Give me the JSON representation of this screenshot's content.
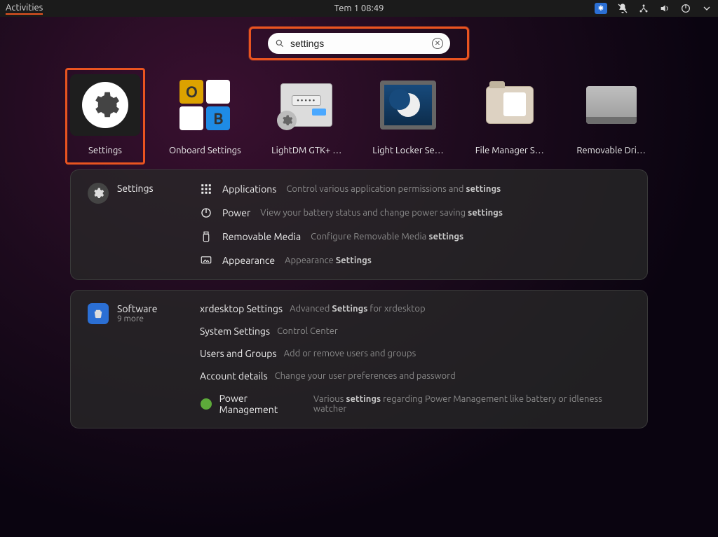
{
  "topbar": {
    "activities": "Activities",
    "clock": "Tem 1  08:49"
  },
  "search": {
    "value": "settings"
  },
  "apps": [
    {
      "id": "settings",
      "label": "Settings",
      "highlighted": true
    },
    {
      "id": "onboard-settings",
      "label": "Onboard Settings",
      "highlighted": false
    },
    {
      "id": "lightdm-gtk",
      "label": "LightDM GTK+ …",
      "highlighted": false
    },
    {
      "id": "light-locker",
      "label": "Light Locker Se…",
      "highlighted": false
    },
    {
      "id": "file-manager",
      "label": "File Manager S…",
      "highlighted": false
    },
    {
      "id": "removable",
      "label": "Removable Dri…",
      "highlighted": false
    }
  ],
  "settings_panel": {
    "title": "Settings",
    "rows": [
      {
        "icon": "grid",
        "label": "Applications",
        "desc_pre": "Control various application permissions and ",
        "desc_bold": "settings",
        "desc_post": ""
      },
      {
        "icon": "power",
        "label": "Power",
        "desc_pre": "View your battery status and change power saving ",
        "desc_bold": "settings",
        "desc_post": ""
      },
      {
        "icon": "usb",
        "label": "Removable Media",
        "desc_pre": "Configure Removable Media ",
        "desc_bold": "settings",
        "desc_post": ""
      },
      {
        "icon": "appearance",
        "label": "Appearance",
        "desc_pre": "Appearance ",
        "desc_bold": "Settings",
        "desc_post": ""
      }
    ]
  },
  "software_panel": {
    "title": "Software",
    "subtitle": "9 more",
    "rows": [
      {
        "label": "xrdesktop Settings",
        "desc_pre": "Advanced ",
        "desc_bold": "Settings",
        "desc_post": " for xrdesktop",
        "dot": false
      },
      {
        "label": "System Settings",
        "desc_pre": "Control Center",
        "desc_bold": "",
        "desc_post": "",
        "dot": false
      },
      {
        "label": "Users and Groups",
        "desc_pre": "Add or remove users and groups",
        "desc_bold": "",
        "desc_post": "",
        "dot": false
      },
      {
        "label": "Account details",
        "desc_pre": "Change your user preferences and password",
        "desc_bold": "",
        "desc_post": "",
        "dot": false
      },
      {
        "label": "Power Management",
        "desc_pre": "Various ",
        "desc_bold": "settings",
        "desc_post": " regarding Power Management like battery or idleness watcher",
        "dot": true
      }
    ]
  }
}
